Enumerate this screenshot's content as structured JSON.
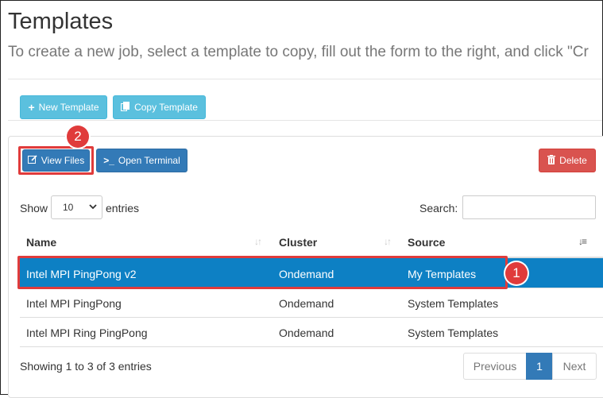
{
  "page": {
    "title": "Templates",
    "subtitle": "To create a new job, select a template to copy, fill out the form to the right, and click \"Cr"
  },
  "top_buttons": {
    "new_template": "New Template",
    "copy_template": "Copy Template"
  },
  "toolbar": {
    "view_files": "View Files",
    "open_terminal": "Open Terminal",
    "delete": "Delete"
  },
  "annotations": {
    "badge_1": "1",
    "badge_2": "2"
  },
  "table_controls": {
    "show_label": "Show",
    "page_length": "10",
    "entries_label": "entries",
    "search_label": "Search:",
    "search_value": ""
  },
  "table": {
    "columns": [
      "Name",
      "Cluster",
      "Source"
    ],
    "rows": [
      {
        "name": "Intel MPI PingPong v2",
        "cluster": "Ondemand",
        "source": "My Templates",
        "selected": true
      },
      {
        "name": "Intel MPI PingPong",
        "cluster": "Ondemand",
        "source": "System Templates",
        "selected": false
      },
      {
        "name": "Intel MPI Ring PingPong",
        "cluster": "Ondemand",
        "source": "System Templates",
        "selected": false
      }
    ],
    "info": "Showing 1 to 3 of 3 entries"
  },
  "pagination": {
    "previous": "Previous",
    "current": "1",
    "next": "Next"
  },
  "colors": {
    "info": "#5bc0de",
    "primary": "#337ab7",
    "danger": "#d9534f",
    "selected_row": "#0d80c4",
    "annotation": "#e03b3b"
  },
  "icons": {
    "new_template": "plus-icon",
    "copy_template": "copy-icon",
    "view_files": "edit-icon",
    "open_terminal": "terminal-icon",
    "delete": "trash-icon"
  }
}
